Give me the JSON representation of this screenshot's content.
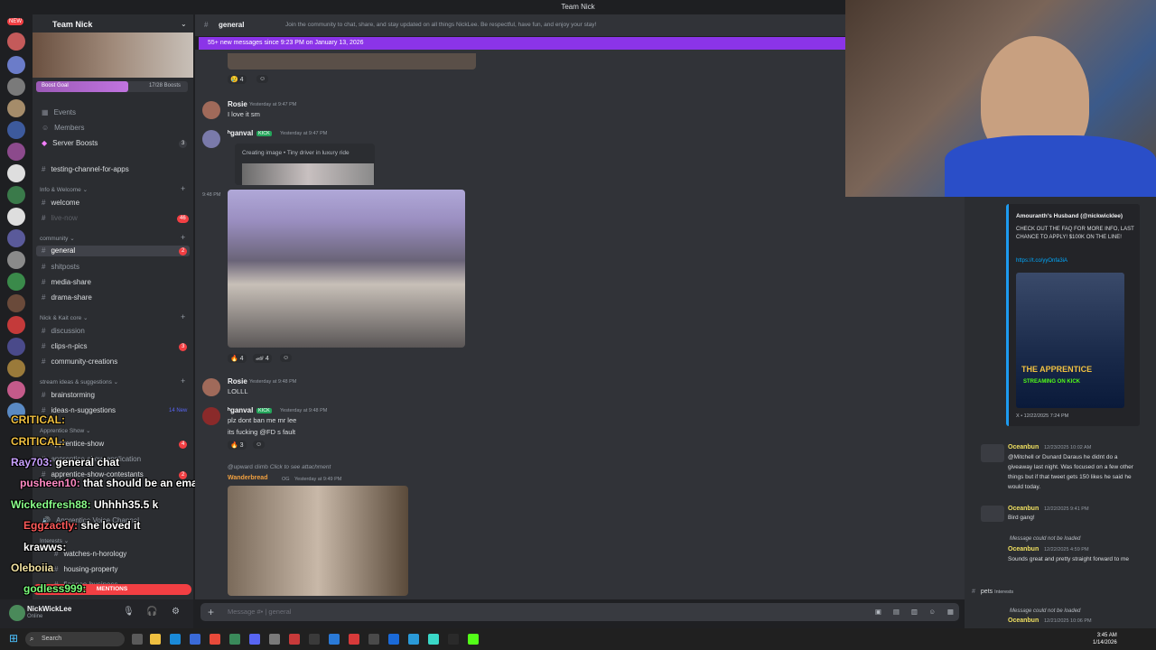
{
  "window": {
    "title": "Team Nick"
  },
  "server": {
    "name": "Team Nick",
    "new_badge": "NEW"
  },
  "boost": {
    "label": "Boost Goal",
    "progress": "17/28 Boosts",
    "fraction": 0.607
  },
  "sidebar": {
    "top_items": [
      {
        "label": "Events"
      },
      {
        "label": "Members"
      },
      {
        "label": "Server Boosts",
        "count": "3"
      },
      {
        "label": "testing-channel-for-apps"
      }
    ],
    "categories": [
      {
        "label": "Info & Welcome"
      },
      {
        "label": "community"
      },
      {
        "label": "Nick & Kait core"
      },
      {
        "label": "stream ideas & suggestions"
      },
      {
        "label": "Apprentice Show"
      },
      {
        "label": "Interests"
      }
    ],
    "channels": [
      {
        "label": "welcome"
      },
      {
        "label": "live-now",
        "count": "46"
      },
      {
        "label": "general",
        "count": "2"
      },
      {
        "label": "shitposts"
      },
      {
        "label": "media-share"
      },
      {
        "label": "drama-share"
      },
      {
        "label": "discussion"
      },
      {
        "label": "clips-n-pics",
        "count": "3"
      },
      {
        "label": "community-creations"
      },
      {
        "label": "brainstorming"
      },
      {
        "label": "ideas-n-suggestions",
        "count": "14 New"
      },
      {
        "label": "apprentice-show",
        "count": "4"
      },
      {
        "label": "apprentice-show-application"
      },
      {
        "label": "apprentice-show-contestants",
        "count": "2"
      },
      {
        "label": "Apprentice Voice Channel"
      },
      {
        "label": "watches-n-horology"
      },
      {
        "label": "housing-property"
      },
      {
        "label": "finance-business"
      }
    ],
    "mentions_banner": "MENTIONS",
    "user": {
      "name": "NickWickLee",
      "status": "Online"
    }
  },
  "chat_overlay": [
    {
      "user": "CRITICAL:",
      "text": ""
    },
    {
      "user": "CRITICAL:",
      "text": ""
    },
    {
      "user": "Ray703:",
      "text": "general chat"
    },
    {
      "user": "pusheen10:",
      "text": "that should be an email"
    },
    {
      "user": "Wickedfresh88:",
      "text": "Uhhhh35.5 k"
    },
    {
      "user": "Eggzactly:",
      "text": "she loved it"
    },
    {
      "user": "krawws:",
      "text": ""
    },
    {
      "user": "Oleboiia",
      "text": ""
    },
    {
      "user": "godless999:",
      "text": ""
    }
  ],
  "channel": {
    "name": "general",
    "topic": "Join the community to chat, share, and stay updated on all things NickLee. Be respectful, have fun, and enjoy your stay!",
    "new_messages": "55+ new messages since 9:23 PM on January 13, 2026"
  },
  "messages": [
    {
      "user": "Rosie",
      "time": "Yesterday at 9:47 PM",
      "text": "I love it sm"
    },
    {
      "user": "ʰganval",
      "tag": "KICK",
      "time": "Yesterday at 9:47 PM",
      "text": "Creating image • Tiny driver in luxury ride"
    },
    {
      "user": "Rosie",
      "time": "Yesterday at 9:48 PM",
      "text": "LOLLL"
    },
    {
      "user": "ʰganval",
      "tag": "KICK",
      "time": "Yesterday at 9:48 PM",
      "text": "plz dont ban me mr lee",
      "text2": "its fucking @FD s fault"
    },
    {
      "reply": "@upward climb",
      "reply_text": "Click to see attachment",
      "user": "Wanderbread",
      "tag": "OG",
      "time": "Yesterday at 9:49 PM"
    }
  ],
  "side_time": "9:48 PM",
  "reactions": {
    "r1": "4",
    "r2": "4",
    "r3": "4",
    "r4": "3",
    "r5": "3"
  },
  "composer": {
    "placeholder": "Message #• | general"
  },
  "right": {
    "embed_author": "Amouranth's Husband (@nickwicklee)",
    "embed_text": "CHECK OUT THE FAQ FOR MORE INFO, LAST CHANCE TO APPLY! $100K ON THE LINE!",
    "embed_link": "https://t.co/yyOnfa3iA",
    "embed_footer": "X • 12/22/2025 7:24 PM",
    "poster_title": "THE APPRENTICE",
    "poster_sub": "STREAMING ON KICK",
    "feed": [
      {
        "user": "Oceanbun",
        "time": "12/23/2025 10:02 AM",
        "text": "@Mitchell or Dunard Daraus he didnt do a giveaway last night. Was focused on a few other things but if that tweet gets 150 likes he said he would today."
      },
      {
        "user": "Oceanbun",
        "time": "12/22/2025 9:41 PM",
        "text": "Bird gang!"
      },
      {
        "note": "Message could not be loaded",
        "user": "Oceanbun",
        "time": "12/22/2025 4:59 PM",
        "text": "Sounds great and pretty straight forward to me"
      },
      {
        "channel": "pets",
        "tag": "Interests"
      },
      {
        "note": "Message could not be loaded",
        "user": "Oceanbun",
        "time": "12/21/2025 10:06 PM"
      }
    ]
  },
  "taskbar": {
    "search": "Search",
    "time": "3:45 AM",
    "date": "1/14/2026"
  }
}
